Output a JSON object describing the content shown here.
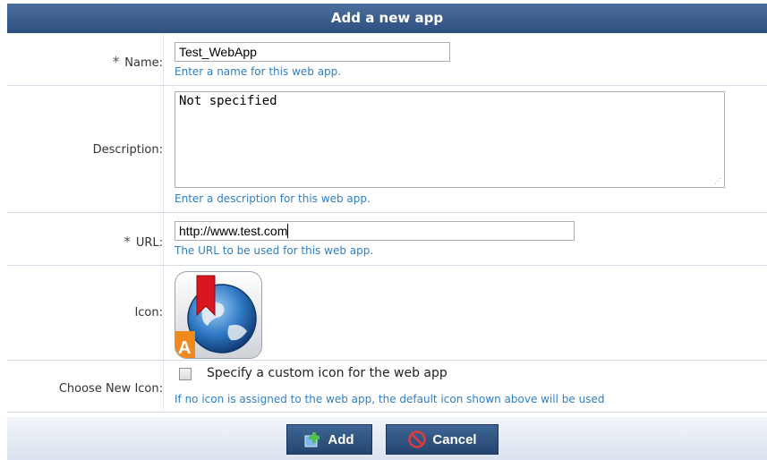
{
  "title": "Add a new app",
  "form": {
    "name": {
      "required_mark": "*",
      "label": "Name:",
      "value": "Test_WebApp",
      "help": "Enter a name for this web app."
    },
    "description": {
      "label": "Description:",
      "value": "Not specified",
      "help": "Enter a description for this web app."
    },
    "url": {
      "required_mark": "*",
      "label": "URL:",
      "value": "http://www.test.com",
      "help": "The URL to be used for this web app."
    },
    "icon": {
      "label": "Icon:",
      "icon_name": "web-app-globe-bookmark-icon"
    },
    "choose_icon": {
      "label": "Choose New Icon:",
      "checkbox_label": "Specify a custom icon for the web app",
      "checked": false,
      "help": "If no icon is assigned to the web app, the default icon shown above will be used"
    }
  },
  "buttons": {
    "add": "Add",
    "cancel": "Cancel"
  },
  "colors": {
    "header": "#34557f",
    "help_text": "#2f7fc1",
    "button": "#2e5283"
  }
}
